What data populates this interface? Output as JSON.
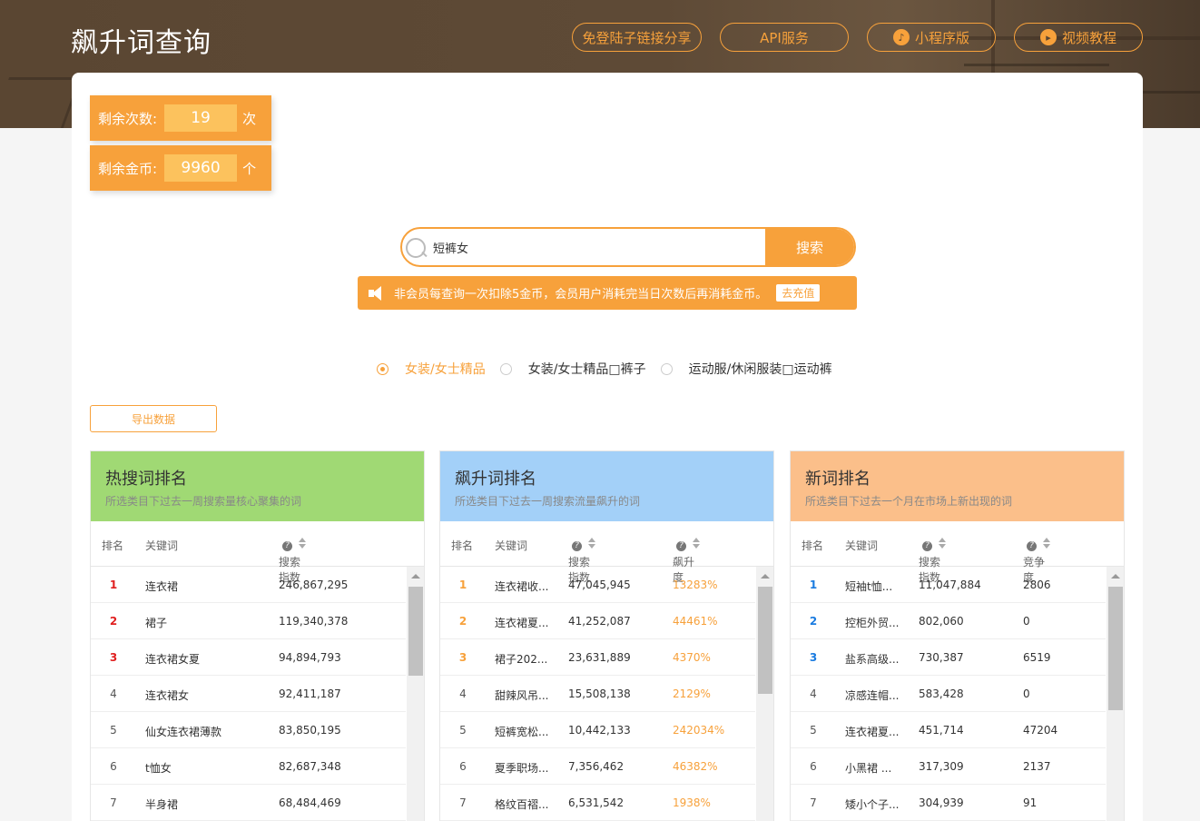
{
  "header": {
    "title": "飙升词查询",
    "buttons": [
      {
        "label": "免登陆子链接分享",
        "icon": ""
      },
      {
        "label": "API服务",
        "icon": ""
      },
      {
        "label": "小程序版",
        "icon": "mini-program-icon"
      },
      {
        "label": "视频教程",
        "icon": "video-icon"
      }
    ]
  },
  "stats": {
    "remaining_count": {
      "label": "剩余次数:",
      "value": "19",
      "unit": "次"
    },
    "remaining_coins": {
      "label": "剩余金币:",
      "value": "9960",
      "unit": "个"
    }
  },
  "search": {
    "value": "短裤女",
    "button": "搜索"
  },
  "notice": {
    "text": "非会员每查询一次扣除5金币，会员用户消耗完当日次数后再消耗金币。",
    "action": "去充值"
  },
  "categories": [
    {
      "label": "女装/女士精品",
      "selected": true
    },
    {
      "label": "女装/女士精品\u0000裤子",
      "selected": false
    },
    {
      "label": "运动服/休闲服装\u0000运动裤",
      "selected": false
    }
  ],
  "export_label": "导出数据",
  "panels": {
    "hot": {
      "title": "热搜词排名",
      "subtitle": "所选类目下过去一周搜索量核心聚集的词",
      "header_color": "#a0d974",
      "columns": [
        "排名",
        "关键词",
        "搜索指数"
      ],
      "rows": [
        {
          "rank": "1",
          "keyword": "连衣裙",
          "index": "246,867,295"
        },
        {
          "rank": "2",
          "keyword": "裙子",
          "index": "119,340,378"
        },
        {
          "rank": "3",
          "keyword": "连衣裙女夏",
          "index": "94,894,793"
        },
        {
          "rank": "4",
          "keyword": "连衣裙女",
          "index": "92,411,187"
        },
        {
          "rank": "5",
          "keyword": "仙女连衣裙薄款",
          "index": "83,850,195"
        },
        {
          "rank": "6",
          "keyword": "t恤女",
          "index": "82,687,348"
        },
        {
          "rank": "7",
          "keyword": "半身裙",
          "index": "68,484,469"
        }
      ]
    },
    "rising": {
      "title": "飙升词排名",
      "subtitle": "所选类目下过去一周搜索流量飙升的词",
      "header_color": "#a3d0f8",
      "columns": [
        "排名",
        "关键词",
        "搜索指数",
        "飙升度"
      ],
      "rows": [
        {
          "rank": "1",
          "keyword": "连衣裙收...",
          "index": "47,045,945",
          "growth": "13283%"
        },
        {
          "rank": "2",
          "keyword": "连衣裙夏...",
          "index": "41,252,087",
          "growth": "44461%"
        },
        {
          "rank": "3",
          "keyword": "裙子202...",
          "index": "23,631,889",
          "growth": "4370%"
        },
        {
          "rank": "4",
          "keyword": "甜辣风吊...",
          "index": "15,508,138",
          "growth": "2129%"
        },
        {
          "rank": "5",
          "keyword": "短裤宽松...",
          "index": "10,442,133",
          "growth": "242034%"
        },
        {
          "rank": "6",
          "keyword": "夏季职场...",
          "index": "7,356,462",
          "growth": "46382%"
        },
        {
          "rank": "7",
          "keyword": "格纹百褶...",
          "index": "6,531,542",
          "growth": "1938%"
        }
      ]
    },
    "new": {
      "title": "新词排名",
      "subtitle": "所选类目下过去一个月在市场上新出现的词",
      "header_color": "#fbbf8a",
      "columns": [
        "排名",
        "关键词",
        "搜索指数",
        "竞争度"
      ],
      "rows": [
        {
          "rank": "1",
          "keyword": "短袖t恤...",
          "index": "11,047,884",
          "competition": "2806"
        },
        {
          "rank": "2",
          "keyword": "控柜外贸...",
          "index": "802,060",
          "competition": "0"
        },
        {
          "rank": "3",
          "keyword": "盐系高级...",
          "index": "730,387",
          "competition": "6519"
        },
        {
          "rank": "4",
          "keyword": "凉感连帽...",
          "index": "583,428",
          "competition": "0"
        },
        {
          "rank": "5",
          "keyword": "连衣裙夏...",
          "index": "451,714",
          "competition": "47204"
        },
        {
          "rank": "6",
          "keyword": "小黑裙 ...",
          "index": "317,309",
          "competition": "2137"
        },
        {
          "rank": "7",
          "keyword": "矮小个子...",
          "index": "304,939",
          "competition": "91"
        }
      ]
    }
  },
  "colors": {
    "accent": "#f7a13b",
    "rank_hot": "#e02020",
    "rank_rising": "#f7a13b",
    "rank_new": "#1a7be0",
    "growth": "#f7a13b"
  }
}
